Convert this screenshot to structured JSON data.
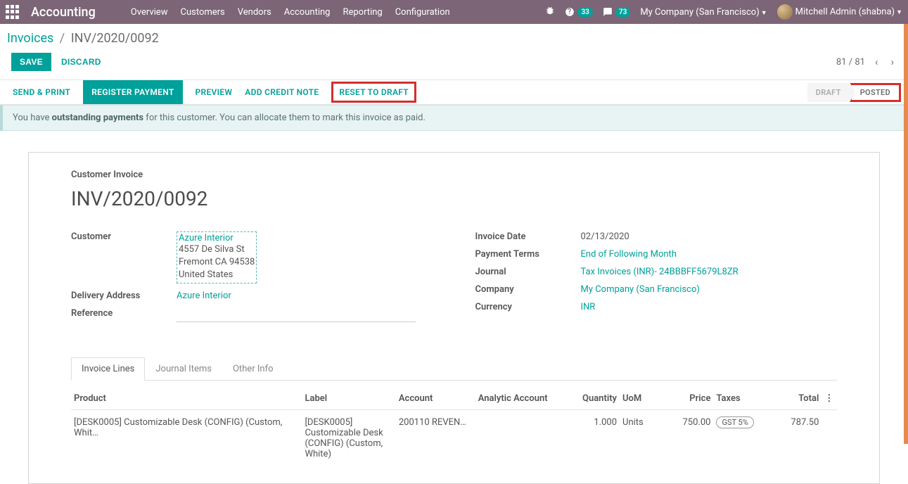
{
  "topbar": {
    "brand": "Accounting",
    "menu": [
      "Overview",
      "Customers",
      "Vendors",
      "Accounting",
      "Reporting",
      "Configuration"
    ],
    "badge_activities": "33",
    "badge_discuss": "73",
    "company": "My Company (San Francisco)",
    "user": "Mitchell Admin (shabna)"
  },
  "breadcrumb": {
    "root": "Invoices",
    "current": "INV/2020/0092"
  },
  "actions": {
    "save": "SAVE",
    "discard": "DISCARD",
    "pager": "81 / 81"
  },
  "status_buttons": [
    "SEND & PRINT",
    "REGISTER PAYMENT",
    "PREVIEW",
    "ADD CREDIT NOTE",
    "RESET TO DRAFT"
  ],
  "status_flow": {
    "draft": "DRAFT",
    "posted": "POSTED"
  },
  "banner": {
    "pre": "You have ",
    "strong": "outstanding payments",
    "post": " for this customer. You can allocate them to mark this invoice as paid."
  },
  "form": {
    "title_small": "Customer Invoice",
    "title": "INV/2020/0092",
    "customer_label": "Customer",
    "customer_name": "Azure Interior",
    "customer_addr1": "4557 De Silva St",
    "customer_addr2": "Fremont CA 94538",
    "customer_addr3": "United States",
    "delivery_label": "Delivery Address",
    "delivery_val": "Azure Interior",
    "reference_label": "Reference",
    "invdate_label": "Invoice Date",
    "invdate_val": "02/13/2020",
    "terms_label": "Payment Terms",
    "terms_val": "End of Following Month",
    "journal_label": "Journal",
    "journal_val": "Tax Invoices (INR)- 24BBBFF5679L8ZR",
    "company_label": "Company",
    "company_val": "My Company (San Francisco)",
    "currency_label": "Currency",
    "currency_val": "INR"
  },
  "tabs": [
    "Invoice Lines",
    "Journal Items",
    "Other Info"
  ],
  "table": {
    "headers": {
      "product": "Product",
      "label": "Label",
      "account": "Account",
      "analytic": "Analytic Account",
      "quantity": "Quantity",
      "uom": "UoM",
      "price": "Price",
      "taxes": "Taxes",
      "total": "Total"
    },
    "row": {
      "product": "[DESK0005] Customizable Desk (CONFIG) (Custom, Whit…",
      "label": "[DESK0005] Customizable Desk (CONFIG) (Custom, White)",
      "account": "200110 REVEN…",
      "analytic": "",
      "quantity": "1.000",
      "uom": "Units",
      "price": "750.00",
      "tax": "GST 5%",
      "total": "787.50"
    }
  }
}
